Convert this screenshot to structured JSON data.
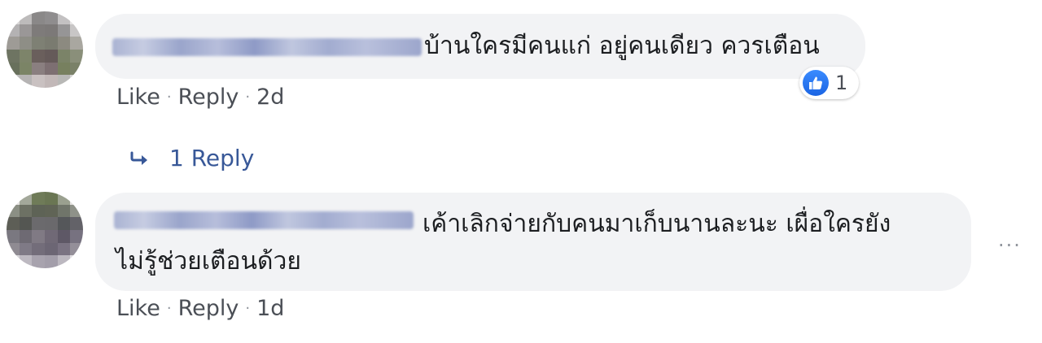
{
  "comments": [
    {
      "text": "บ้านใครมีคนแก่ อยู่คนเดียว ควรเตือน",
      "like_label": "Like",
      "reply_label": "Reply",
      "time": "2d",
      "reaction_count": "1",
      "replies_label": "1 Reply"
    },
    {
      "text_line1": "เค้าเลิกจ่ายกับคนมาเก็บนานละนะ เผื่อใครยัง",
      "text_line2": "ไม่รู้ช่วยเตือนด้วย",
      "like_label": "Like",
      "reply_label": "Reply",
      "time": "1d",
      "more_label": "···"
    }
  ],
  "colors": {
    "bubble": "#f2f3f5",
    "link": "#385898",
    "meta": "#4b4f56",
    "like_blue": "#1a64e3"
  },
  "icons": [
    "avatar",
    "like-reaction-icon",
    "reply-arrow-icon",
    "more-options-icon"
  ]
}
